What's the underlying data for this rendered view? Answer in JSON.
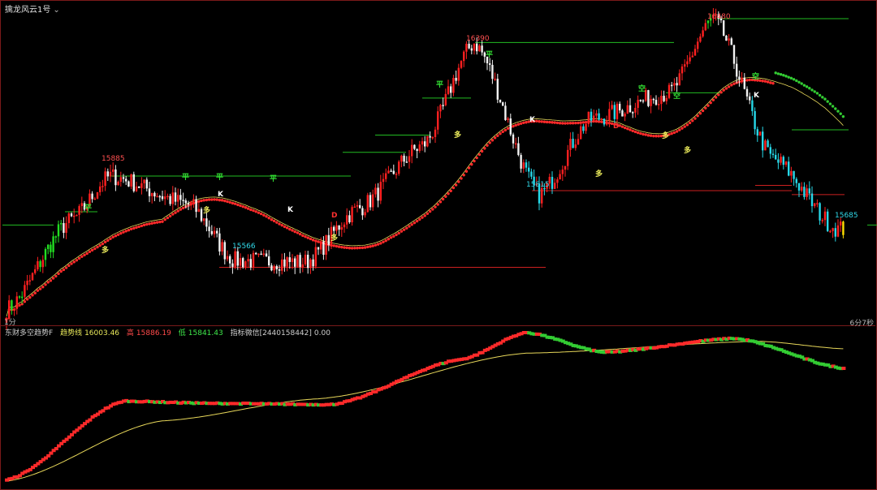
{
  "window": {
    "indicator_name": "擒龙风云1号",
    "period_label": "1分",
    "countdown": "6分7秒"
  },
  "indicator_panel": {
    "name": "东财多空趋势F",
    "items": [
      {
        "label": "趋势线",
        "value": "16003.46",
        "color": "yellow"
      },
      {
        "label": "高",
        "value": "15886.19",
        "color": "red"
      },
      {
        "label": "低",
        "value": "15841.43",
        "color": "green"
      },
      {
        "label": "指标微信[2440158442]",
        "value": "0.00",
        "color": "gray"
      }
    ]
  },
  "colors": {
    "up": "#ff2020",
    "down_white": "#f2f2f2",
    "down_cyan": "#27d8e8",
    "green_bar": "#22dd22",
    "yellow_bar": "#ffe000",
    "ma_line": "#e8d85a",
    "red_dots": "#ff2a2a",
    "green_dots": "#33cc33",
    "level_green": "#22bb22",
    "level_red": "#cc2020",
    "frame": "#7a1a1a"
  },
  "chart_data": [
    {
      "type": "candlestick",
      "title": "",
      "price_labels": [
        {
          "label": "15885",
          "kind": "high"
        },
        {
          "label": "15566",
          "kind": "low"
        },
        {
          "label": "16390",
          "kind": "high"
        },
        {
          "label": "15815",
          "kind": "low"
        },
        {
          "label": "16480",
          "kind": "high"
        },
        {
          "label": "15685",
          "kind": "low"
        }
      ],
      "signals": [
        {
          "label": "平",
          "color": "#33dd33"
        },
        {
          "label": "多",
          "color": "#e8e85a"
        },
        {
          "label": "平",
          "color": "#33dd33"
        },
        {
          "label": "平",
          "color": "#33dd33"
        },
        {
          "label": "K",
          "color": "#ffffff"
        },
        {
          "label": "多",
          "color": "#e8e85a"
        },
        {
          "label": "平",
          "color": "#33dd33"
        },
        {
          "label": "K",
          "color": "#ffffff"
        },
        {
          "label": "D",
          "color": "#ff3030"
        },
        {
          "label": "多",
          "color": "#e8e85a"
        },
        {
          "label": "平",
          "color": "#33dd33"
        },
        {
          "label": "多",
          "color": "#e8e85a"
        },
        {
          "label": "平",
          "color": "#33dd33"
        },
        {
          "label": "K",
          "color": "#ffffff"
        },
        {
          "label": "多",
          "color": "#e8e85a"
        },
        {
          "label": "D",
          "color": "#ff3030"
        },
        {
          "label": "空",
          "color": "#33dd33"
        },
        {
          "label": "空",
          "color": "#33dd33"
        },
        {
          "label": "多",
          "color": "#e8e85a"
        },
        {
          "label": "多",
          "color": "#e8e85a"
        },
        {
          "label": "空",
          "color": "#33dd33"
        },
        {
          "label": "K",
          "color": "#ffffff"
        }
      ],
      "key_price_path": [
        {
          "bar": 0,
          "price": 15380
        },
        {
          "bar": 25,
          "price": 15720
        },
        {
          "bar": 40,
          "price": 15885
        },
        {
          "bar": 70,
          "price": 15780
        },
        {
          "bar": 88,
          "price": 15566
        },
        {
          "bar": 115,
          "price": 15560
        },
        {
          "bar": 135,
          "price": 15760
        },
        {
          "bar": 160,
          "price": 16000
        },
        {
          "bar": 180,
          "price": 16390
        },
        {
          "bar": 205,
          "price": 15815
        },
        {
          "bar": 225,
          "price": 16100
        },
        {
          "bar": 255,
          "price": 16200
        },
        {
          "bar": 272,
          "price": 16480
        },
        {
          "bar": 295,
          "price": 15950
        },
        {
          "bar": 320,
          "price": 15685
        }
      ]
    },
    {
      "type": "line",
      "title": "东财多空趋势F",
      "series": [
        {
          "name": "趋势线",
          "key_points": [
            [
              0,
              14900
            ],
            [
              60,
              15420
            ],
            [
              120,
              15610
            ],
            [
              200,
              16003
            ],
            [
              290,
              16105
            ],
            [
              323,
              16040
            ]
          ]
        },
        {
          "name": "高",
          "key_points": [
            [
              0,
              14910
            ],
            [
              45,
              15590
            ],
            [
              80,
              15570
            ],
            [
              125,
              15560
            ],
            [
              175,
              15950
            ],
            [
              200,
              16180
            ],
            [
              230,
              16010
            ],
            [
              280,
              16130
            ],
            [
              323,
              15870
            ]
          ]
        }
      ]
    }
  ]
}
